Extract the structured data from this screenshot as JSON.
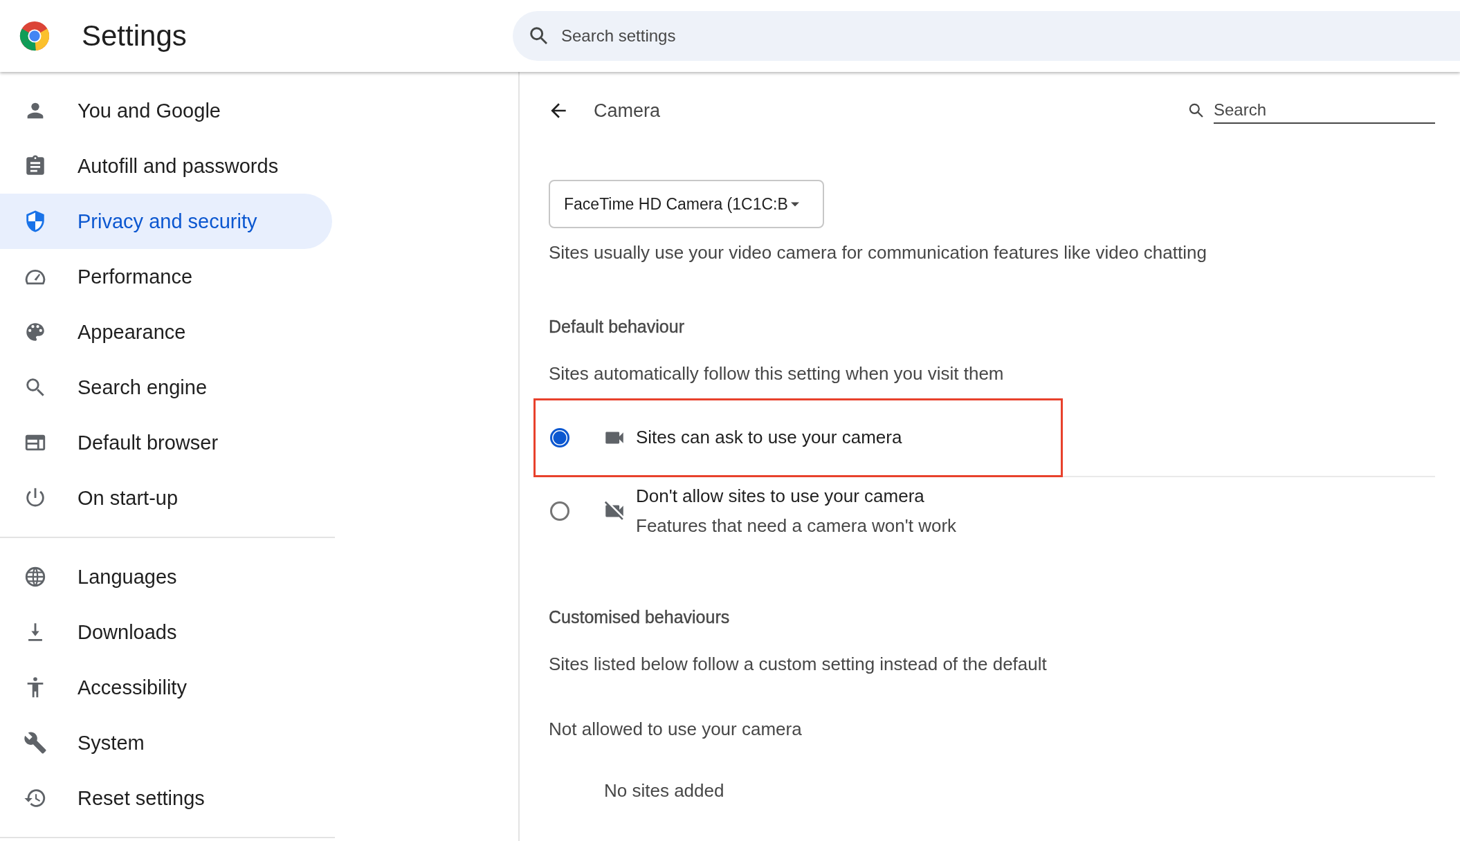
{
  "header": {
    "title": "Settings",
    "search": {
      "placeholder": "Search settings"
    }
  },
  "sidebar": {
    "sections": [
      {
        "items": [
          {
            "label": "You and Google",
            "selected": false
          },
          {
            "label": "Autofill and passwords",
            "selected": false
          },
          {
            "label": "Privacy and security",
            "selected": true
          },
          {
            "label": "Performance",
            "selected": false
          },
          {
            "label": "Appearance",
            "selected": false
          },
          {
            "label": "Search engine",
            "selected": false
          },
          {
            "label": "Default browser",
            "selected": false
          },
          {
            "label": "On start-up",
            "selected": false
          }
        ]
      },
      {
        "items": [
          {
            "label": "Languages",
            "selected": false
          },
          {
            "label": "Downloads",
            "selected": false
          },
          {
            "label": "Accessibility",
            "selected": false
          },
          {
            "label": "System",
            "selected": false
          },
          {
            "label": "Reset settings",
            "selected": false
          }
        ]
      }
    ]
  },
  "page": {
    "title": "Camera",
    "search": {
      "placeholder": "Search"
    },
    "device_select": {
      "value": "FaceTime HD Camera (1C1C:B"
    },
    "description": "Sites usually use your video camera for communication features like video chatting",
    "default_behaviour": {
      "heading": "Default behaviour",
      "description": "Sites automatically follow this setting when you visit them",
      "options": [
        {
          "kind": "allow",
          "label": "Sites can ask to use your camera",
          "selected": true,
          "highlighted": true
        },
        {
          "kind": "block",
          "label": "Don't allow sites to use your camera",
          "sublabel": "Features that need a camera won't work",
          "selected": false,
          "highlighted": false
        }
      ]
    },
    "customised_behaviours": {
      "heading": "Customised behaviours",
      "description": "Sites listed below follow a custom setting instead of the default",
      "lists": [
        {
          "heading": "Not allowed to use your camera",
          "empty_text": "No sites added"
        }
      ]
    }
  }
}
